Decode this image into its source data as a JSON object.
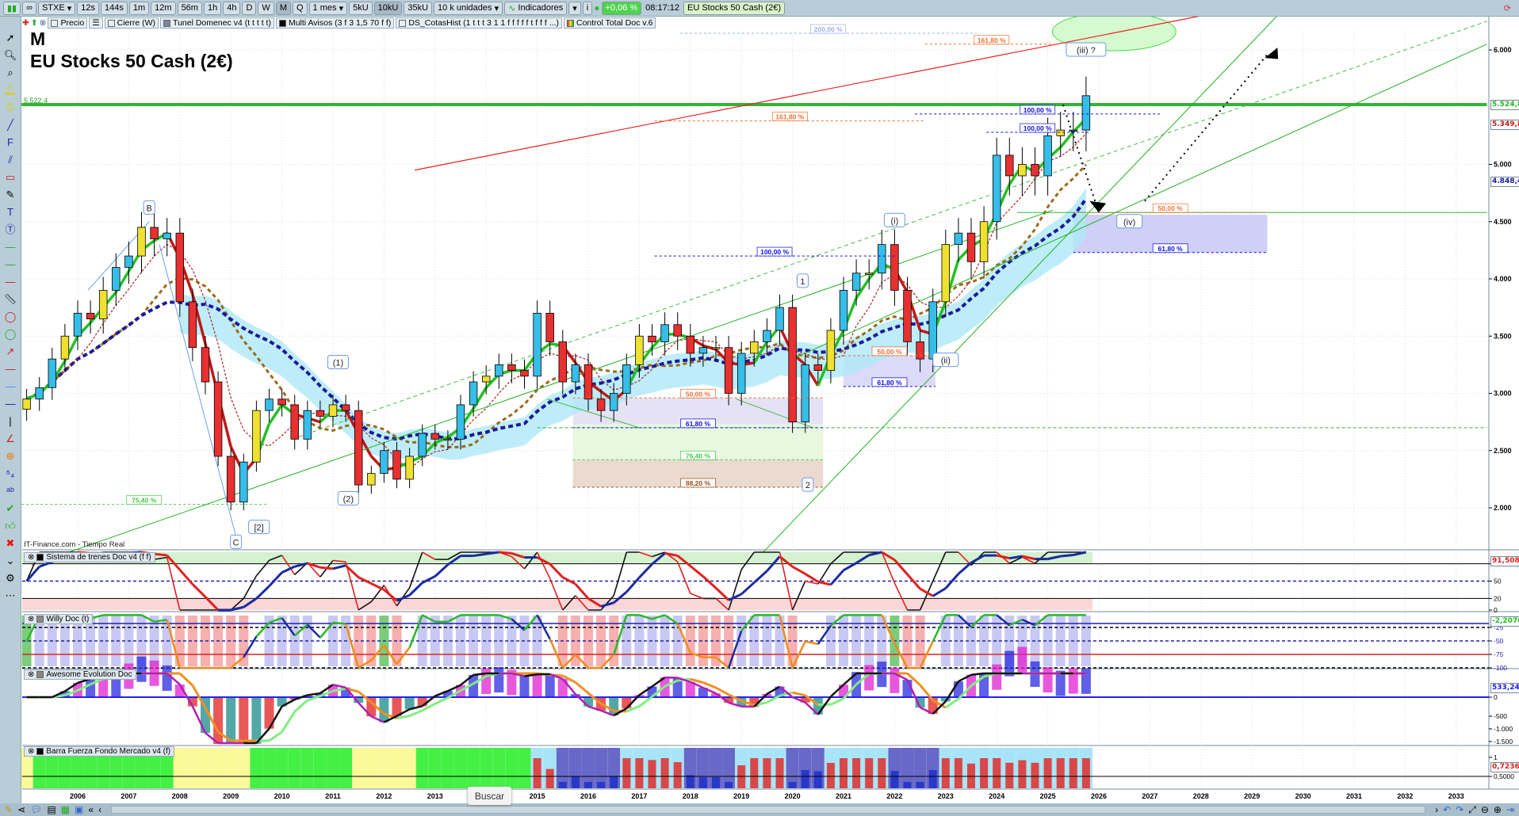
{
  "toolbar": {
    "symbol": "STXE",
    "timeframes": [
      "12s",
      "144s",
      "1m",
      "12m",
      "56m",
      "1h",
      "4h",
      "D",
      "W",
      "M",
      "Q"
    ],
    "active_timeframe": "M",
    "period": "1 mes",
    "volume_buttons": [
      "5kU",
      "10kU",
      "35kU"
    ],
    "active_volume": "10kU",
    "units": "10 k unidades",
    "indicators_label": "Indicadores",
    "change": "+0,06 %",
    "time": "08:17:12",
    "instrument_title": "EU Stocks 50 Cash (2€)"
  },
  "legend_row": [
    "Precio",
    "Cierre (W)",
    "Tunel Domenec v4 (t t t t t)",
    "Multi Avisos (3 f 3 1,5 70 f f)",
    "DS_CotasHist (1 t t t 3 1 1 f f f f f t f f f ...)",
    "Control Total Doc v.6"
  ],
  "chart": {
    "timeframe_letter": "M",
    "title": "EU Stocks 50 Cash (2€)",
    "left_price_label": "5.522,4",
    "source": "IT-Finance.com - Tiempo Real",
    "price_ticks": [
      "6.000",
      "5.000",
      "4.500",
      "4.000",
      "3.500",
      "3.000",
      "2.500",
      "2.000"
    ],
    "price_tick_values": [
      6000,
      5000,
      4500,
      4000,
      3500,
      3000,
      2500,
      2000
    ],
    "axis_tags": [
      {
        "text": "5.524,8",
        "value": 5524.8,
        "color": "#22b422"
      },
      {
        "text": "5.349,8",
        "value": 5349.8,
        "color": "#c01818"
      },
      {
        "text": "4.848,4",
        "value": 4848.4,
        "color": "#1a1aa0"
      }
    ],
    "years": [
      "2006",
      "2007",
      "2008",
      "2009",
      "2010",
      "2011",
      "2012",
      "2013",
      "2014",
      "2015",
      "2016",
      "2017",
      "2018",
      "2019",
      "2020",
      "2021",
      "2022",
      "2023",
      "2024",
      "2025",
      "2026",
      "2027",
      "2028",
      "2029",
      "2030",
      "2031",
      "2032",
      "2033"
    ]
  },
  "chart_data": {
    "type": "candlestick",
    "title": "EU Stocks 50 Cash (2€)",
    "x_start": 2005.0,
    "x_step": 0.25,
    "closes": [
      2950,
      3050,
      3300,
      3500,
      3700,
      3650,
      3900,
      4100,
      4200,
      4450,
      4350,
      4400,
      3800,
      3400,
      3100,
      2450,
      2050,
      2400,
      2850,
      2950,
      2900,
      2600,
      2850,
      2800,
      2900,
      2850,
      2200,
      2300,
      2500,
      2250,
      2450,
      2650,
      2600,
      2600,
      2900,
      3100,
      3150,
      3250,
      3200,
      3150,
      3700,
      3450,
      3100,
      3250,
      2950,
      2850,
      3000,
      3250,
      3500,
      3450,
      3600,
      3500,
      3350,
      3400,
      3400,
      3000,
      3350,
      3450,
      3550,
      3750,
      2750,
      3250,
      3200,
      3550,
      3900,
      4050,
      4050,
      4300,
      3900,
      3450,
      3300,
      3800,
      4300,
      4400,
      4150,
      4500,
      5080,
      4900,
      5000,
      4900,
      5250,
      5300,
      5300,
      5600
    ],
    "ylim": [
      1600,
      6300
    ],
    "xlim": [
      2004.9,
      2033.6
    ]
  },
  "drawings": {
    "lines": [
      {
        "from": [
          2012.6,
          4950
        ],
        "to": [
          2028.6,
          6350
        ],
        "color": "#e82020",
        "w": 1.2
      },
      {
        "from": [
          2005.1,
          1500
        ],
        "to": [
          2025.1,
          4600
        ],
        "color": "#22b422",
        "w": 1
      },
      {
        "from": [
          2019.4,
          1600
        ],
        "to": [
          2029.5,
          6300
        ],
        "color": "#22b422",
        "w": 1
      },
      {
        "from": [
          2020.0,
          3300
        ],
        "to": [
          2033.6,
          6050
        ],
        "color": "#22b422",
        "w": 1
      },
      {
        "from": [
          2010.2,
          2600
        ],
        "to": [
          2033.6,
          6250
        ],
        "color": "#44bb44",
        "w": 1,
        "dash": "5,4"
      },
      {
        "from": [
          2025.3,
          5520
        ],
        "to": [
          2026.0,
          4580
        ],
        "color": "#000",
        "w": 2,
        "dash": "2,5"
      },
      {
        "from": [
          2026.9,
          4680
        ],
        "to": [
          2029.3,
          5960
        ],
        "color": "#000",
        "w": 2,
        "dash": "2,5"
      },
      {
        "from": [
          2006.2,
          3900
        ],
        "to": [
          2007.4,
          4500
        ],
        "color": "#6aa0f0",
        "w": 1
      },
      {
        "from": [
          2007.6,
          4300
        ],
        "to": [
          2009.1,
          1750
        ],
        "color": "#6aa0f0",
        "w": 1
      },
      {
        "from": [
          2015.2,
          2950
        ],
        "to": [
          2017.0,
          2700
        ],
        "color": "#44bb44",
        "w": 1
      },
      {
        "from": [
          2018.9,
          2950
        ],
        "to": [
          2020.4,
          2700
        ],
        "color": "#44bb44",
        "w": 1
      }
    ],
    "hlines": [
      {
        "y": 5522.4,
        "x1": 2004.9,
        "x2": 2033.6,
        "color": "#33b533",
        "w": 4
      },
      {
        "y": 4580,
        "x1": 2024.4,
        "x2": 2033.6,
        "color": "#33b533",
        "w": 1
      },
      {
        "y": 2700,
        "x1": 2015.0,
        "x2": 2033.6,
        "color": "#33b533",
        "w": 1,
        "dash": "4,3"
      }
    ],
    "zones": [
      {
        "x1": 2004.9,
        "x2": 2009.7,
        "y1": 1600,
        "y2": 2030,
        "color": "#e8d6cc"
      },
      {
        "x1": 2015.7,
        "x2": 2020.6,
        "y1": 2960,
        "y2": 2730,
        "color": "#e6e2f6"
      },
      {
        "x1": 2015.7,
        "x2": 2020.6,
        "y1": 2730,
        "y2": 2420,
        "color": "#e8f8e0"
      },
      {
        "x1": 2015.7,
        "x2": 2020.6,
        "y1": 2420,
        "y2": 2180,
        "color": "#eadad0"
      },
      {
        "x1": 2021.0,
        "x2": 2022.8,
        "y1": 3330,
        "y2": 3060,
        "color": "#dcdaf8"
      },
      {
        "x1": 2025.5,
        "x2": 2029.3,
        "y1": 4560,
        "y2": 4230,
        "color": "#cfcff8"
      }
    ],
    "fibs": [
      {
        "text": "200,00 %",
        "y": 6145,
        "x1": 2017.8,
        "x2": 2023.6,
        "color": "#9cb0ea"
      },
      {
        "text": "161,80 %",
        "y": 6050,
        "x1": 2022.6,
        "x2": 2025.2,
        "color": "#f07030"
      },
      {
        "text": "161,80 %",
        "y": 5380,
        "x1": 2017.3,
        "x2": 2022.6,
        "color": "#f07030"
      },
      {
        "text": "100,00 %",
        "y": 5440,
        "x1": 2022.4,
        "x2": 2027.2,
        "color": "#1010e0"
      },
      {
        "text": "100,00 %",
        "y": 5280,
        "x1": 2023.8,
        "x2": 2025.8,
        "color": "#1010e0"
      },
      {
        "text": "100,00 %",
        "y": 4200,
        "x1": 2017.3,
        "x2": 2022.0,
        "color": "#1010e0"
      },
      {
        "text": "50,00 %",
        "y": 2960,
        "x1": 2015.7,
        "x2": 2020.6,
        "color": "#f07030"
      },
      {
        "text": "61,80 %",
        "y": 2700,
        "x1": 2015.7,
        "x2": 2020.6,
        "color": "#1010e0"
      },
      {
        "text": "76,40 %",
        "y": 2420,
        "x1": 2015.7,
        "x2": 2020.6,
        "color": "#44cc44"
      },
      {
        "text": "88,20 %",
        "y": 2180,
        "x1": 2015.7,
        "x2": 2020.6,
        "color": "#a05020"
      },
      {
        "text": "75,40 %",
        "y": 2030,
        "x1": 2004.9,
        "x2": 2009.7,
        "color": "#44cc44"
      },
      {
        "text": "50,00 %",
        "y": 3330,
        "x1": 2021.0,
        "x2": 2022.8,
        "color": "#f07030"
      },
      {
        "text": "61,80 %",
        "y": 3060,
        "x1": 2021.0,
        "x2": 2022.8,
        "color": "#1010e0"
      },
      {
        "text": "50,00 %",
        "y": 4580,
        "x1": 2025.5,
        "x2": 2029.3,
        "color": "#f07030"
      },
      {
        "text": "61,80 %",
        "y": 4230,
        "x1": 2025.5,
        "x2": 2029.3,
        "color": "#1010e0"
      }
    ],
    "waves": [
      {
        "text": "B",
        "x": 2007.4,
        "y": 4620
      },
      {
        "text": "C",
        "x": 2009.1,
        "y": 1700
      },
      {
        "text": "[2]",
        "x": 2009.55,
        "y": 1830
      },
      {
        "text": "(1)",
        "x": 2011.1,
        "y": 3270
      },
      {
        "text": "(2)",
        "x": 2011.3,
        "y": 2080
      },
      {
        "text": "1",
        "x": 2020.2,
        "y": 3980
      },
      {
        "text": "2",
        "x": 2020.3,
        "y": 2200
      },
      {
        "text": "(i)",
        "x": 2022.0,
        "y": 4510
      },
      {
        "text": "(ii)",
        "x": 2023.0,
        "y": 3290
      },
      {
        "text": "(iii) ?",
        "x": 2025.75,
        "y": 6000
      },
      {
        "text": "(iv)",
        "x": 2026.6,
        "y": 4500
      }
    ]
  },
  "panels": [
    {
      "title": "Sistema de trenes Doc v4 (f f)",
      "ticks": [
        "80",
        "50",
        "20",
        "0"
      ],
      "tag": {
        "text": "91,508",
        "color": "#e02020"
      }
    },
    {
      "title": "Willy Doc (t)",
      "ticks": [
        "-25",
        "-50",
        "-75",
        "-100"
      ],
      "tag": {
        "text": "-2,2070",
        "color": "#20c020"
      }
    },
    {
      "title": "Awesome Evolution Doc",
      "ticks": [
        "0",
        "-500",
        "-1.000",
        "-1.500"
      ],
      "tag": {
        "text": "533,24",
        "color": "#1a1ae0"
      }
    },
    {
      "title": "Barra Fuerza Fondo Mercado v4 (f)",
      "ticks": [
        "1",
        "0,5000"
      ],
      "tag": {
        "text": "0,7236",
        "color": "#e02020"
      }
    }
  ],
  "tooltip": "Buscar"
}
